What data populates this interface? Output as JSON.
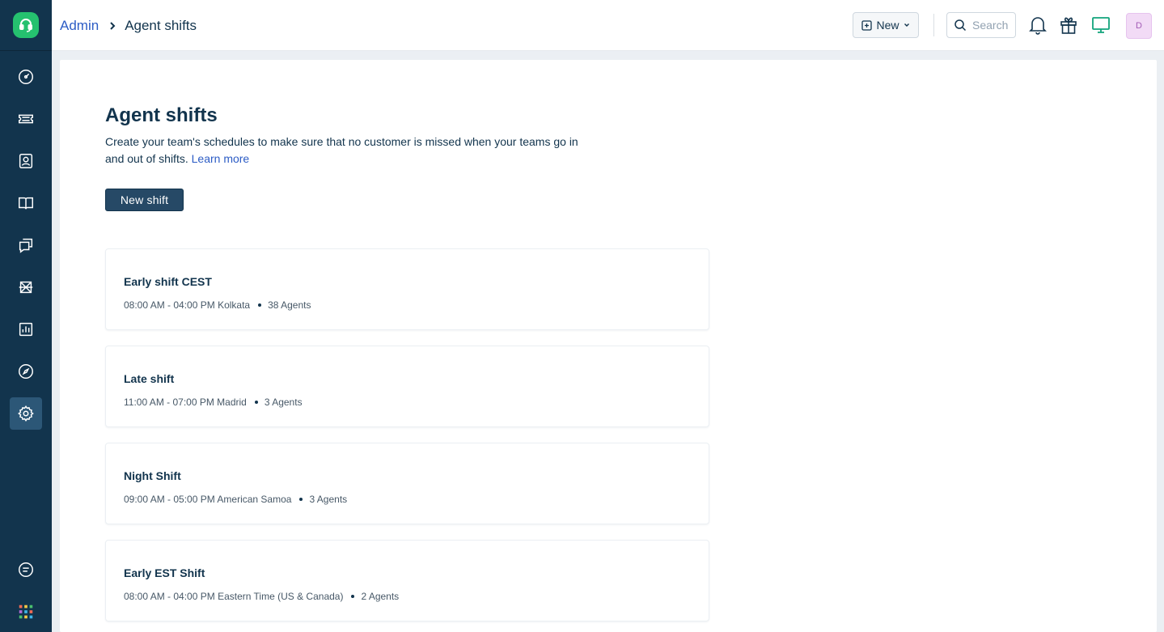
{
  "sidebar": {
    "items": [
      {
        "name": "dashboard"
      },
      {
        "name": "tickets"
      },
      {
        "name": "contacts"
      },
      {
        "name": "solutions"
      },
      {
        "name": "forums"
      },
      {
        "name": "assets"
      },
      {
        "name": "reports"
      },
      {
        "name": "tools"
      },
      {
        "name": "admin"
      }
    ],
    "active": "admin"
  },
  "header": {
    "breadcrumb_parent": "Admin",
    "breadcrumb_current": "Agent shifts",
    "new_label": "New",
    "search_placeholder": "Search",
    "avatar_initial": "D"
  },
  "page": {
    "title": "Agent shifts",
    "description": "Create your team's schedules to make sure that no customer is missed when your teams go in and out of shifts.",
    "learn_more": "Learn more",
    "new_shift_label": "New shift"
  },
  "shifts": [
    {
      "name": "Early shift CEST",
      "time": "08:00 AM - 04:00 PM Kolkata",
      "agents": "38 Agents"
    },
    {
      "name": "Late shift",
      "time": "11:00 AM - 07:00 PM Madrid",
      "agents": "3 Agents"
    },
    {
      "name": "Night Shift",
      "time": "09:00 AM - 05:00 PM American Samoa",
      "agents": "3 Agents"
    },
    {
      "name": "Early EST Shift",
      "time": "08:00 AM - 04:00 PM Eastern Time (US & Canada)",
      "agents": "2 Agents"
    }
  ],
  "colors": {
    "sidebar_bg": "#12344d",
    "accent_link": "#2c5cc5",
    "primary_button": "#264966",
    "logo_green": "#25c16f"
  }
}
